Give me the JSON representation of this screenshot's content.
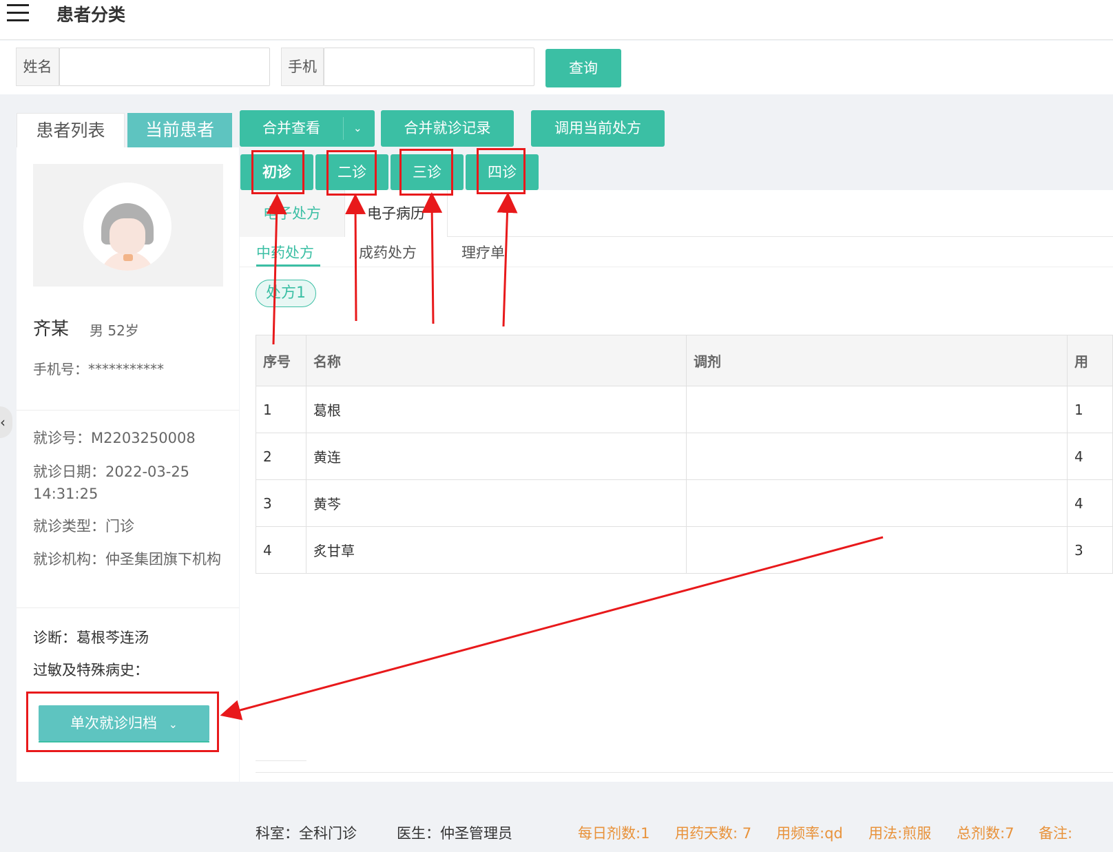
{
  "header": {
    "title": "患者分类"
  },
  "search": {
    "name_label": "姓名",
    "phone_label": "手机",
    "query_label": "查询"
  },
  "left_tabs": [
    "患者列表",
    "当前患者"
  ],
  "patient": {
    "name": "齐某",
    "sex_age": "男 52岁",
    "phone": "手机号：***********",
    "visit_no": "就诊号：M2203250008",
    "visit_date": "就诊日期：2022-03-25 14:31:25",
    "visit_type": "就诊类型：门诊",
    "institution": "就诊机构：仲圣集团旗下机构",
    "diagnosis": "诊断：葛根芩连汤",
    "allergy": "过敏及特殊病史：",
    "archive_label": "单次就诊归档"
  },
  "actions": {
    "merge_view": "合并查看",
    "merge_records": "合并就诊记录",
    "use_current": "调用当前处方"
  },
  "stages": [
    "初诊",
    "二诊",
    "三诊",
    "四诊"
  ],
  "content_tabs": {
    "rx": "电子处方",
    "record": "电子病历"
  },
  "sub_tabs": [
    "中药处方",
    "成药处方",
    "理疗单"
  ],
  "prescription_pill": "处方1",
  "table": {
    "headers": [
      "序号",
      "名称",
      "调剂",
      "用"
    ],
    "rows": [
      [
        "1",
        "葛根",
        "",
        "1"
      ],
      [
        "2",
        "黄连",
        "",
        "4"
      ],
      [
        "3",
        "黄芩",
        "",
        "4"
      ],
      [
        "4",
        "炙甘草",
        "",
        "3"
      ]
    ]
  },
  "footer": {
    "dept": "科室：全科门诊",
    "doctor": "医生：仲圣管理员",
    "daily": "每日剂数:1",
    "days": "用药天数: 7",
    "freq": "用频率:qd",
    "usage": "用法:煎服",
    "total": "总剂数:7",
    "note": "备注:"
  },
  "colors": {
    "primary": "#3bbfa4",
    "teal_tab": "#5ec4c0",
    "annotation": "#e8191b",
    "orange": "#e8923a"
  }
}
